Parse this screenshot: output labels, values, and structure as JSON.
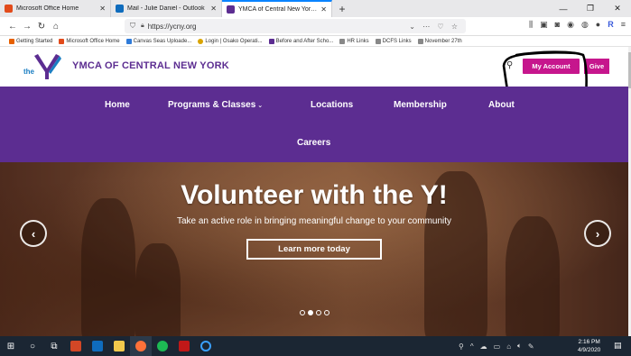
{
  "browser": {
    "tabs": [
      {
        "title": "Microsoft Office Home",
        "color": "#e24b1b"
      },
      {
        "title": "Mail - Julie Daniel - Outlook",
        "color": "#0f6cbd"
      },
      {
        "title": "YMCA of Central New York | Ym",
        "color": "#5c2d91"
      }
    ],
    "new_tab": "+",
    "url": "https://ycny.org",
    "bookmarks": [
      {
        "label": "Getting Started",
        "color": "#e66000"
      },
      {
        "label": "Microsoft Office Home",
        "color": "#e24b1b"
      },
      {
        "label": "Canvas Seas Uploade...",
        "color": "#2f7bd9"
      },
      {
        "label": "Login | Osako Operati...",
        "color": "#d9a400"
      },
      {
        "label": "Before and After Scho...",
        "color": "#5c2d91"
      },
      {
        "label": "HR Links",
        "color": "#777777"
      },
      {
        "label": "DCFS Links",
        "color": "#777777"
      },
      {
        "label": "November 27th",
        "color": "#777777"
      }
    ]
  },
  "site": {
    "logo_text": "the",
    "org_name": "YMCA OF CENTRAL NEW YORK",
    "my_account": "My Account",
    "give": "Give",
    "brand_purple": "#5c2d91",
    "brand_magenta": "#c6168d",
    "menu": {
      "home": "Home",
      "programs": "Programs & Classes",
      "locations": "Locations",
      "membership": "Membership",
      "about": "About",
      "careers": "Careers"
    },
    "hero": {
      "title": "Volunteer with the Y!",
      "subtitle": "Take an active role in bringing meaningful change to your community",
      "cta": "Learn more today",
      "slide_count": 4,
      "active_slide": 2
    }
  },
  "taskbar": {
    "time": "2:16 PM",
    "date": "4/9/2020"
  }
}
